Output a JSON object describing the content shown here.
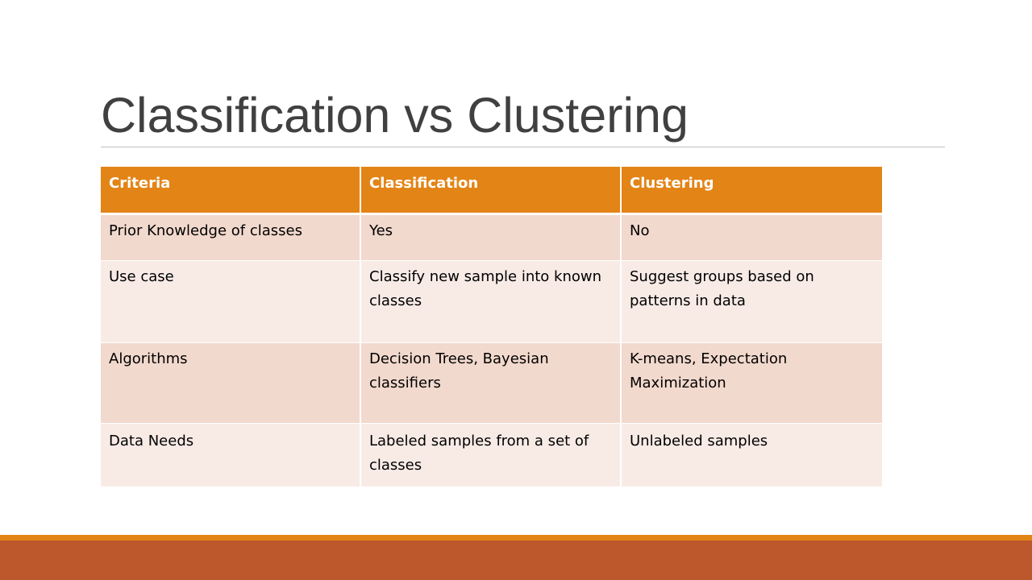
{
  "slide": {
    "title": "Classification vs Clustering"
  },
  "table": {
    "headers": [
      "Criteria",
      "Classification",
      "Clustering"
    ],
    "rows": [
      [
        "Prior Knowledge of classes",
        "Yes",
        "No"
      ],
      [
        "Use case",
        "Classify new sample into known classes",
        "Suggest groups based on patterns in data"
      ],
      [
        "Algorithms",
        "Decision Trees, Bayesian classifiers",
        "K-means, Expectation Maximization"
      ],
      [
        "Data Needs",
        "Labeled samples from a set of classes",
        "Unlabeled samples"
      ]
    ]
  },
  "colors": {
    "header_fill": "#e38416",
    "row_dark": "#f2d9cd",
    "row_light": "#f8ebe6",
    "band_accent": "#e38416",
    "band_base": "#bd582c",
    "title_text": "#404040"
  }
}
